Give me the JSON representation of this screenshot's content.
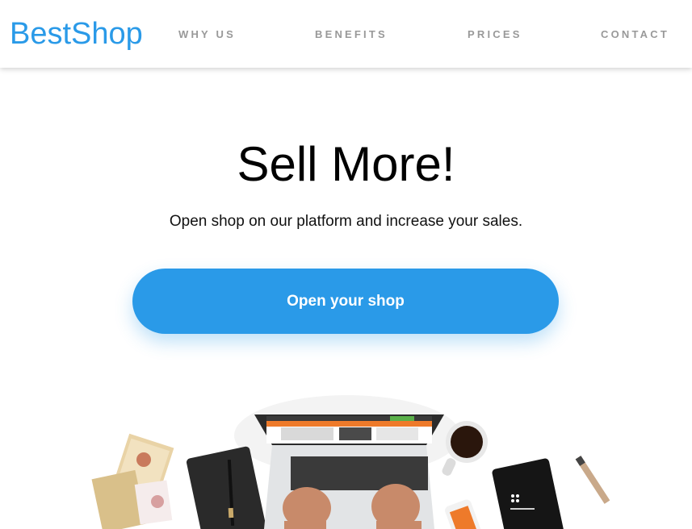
{
  "header": {
    "logo": "BestShop",
    "nav": [
      {
        "label": "WHY US"
      },
      {
        "label": "BENEFITS"
      },
      {
        "label": "PRICES"
      },
      {
        "label": "CONTACT"
      }
    ]
  },
  "hero": {
    "title": "Sell More!",
    "subtitle": "Open shop on our platform and increase your sales.",
    "cta_label": "Open your shop"
  },
  "colors": {
    "accent": "#2a9ae8",
    "nav_text": "#999999",
    "heading": "#000000"
  }
}
